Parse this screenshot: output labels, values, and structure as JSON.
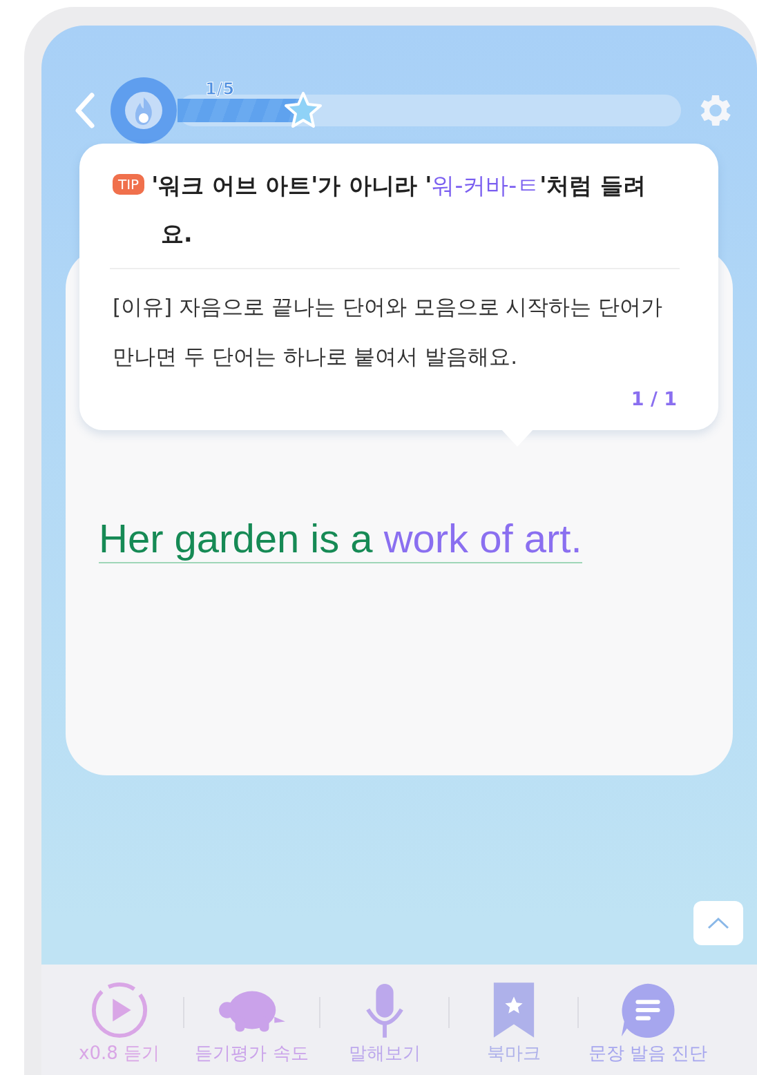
{
  "progress": {
    "label": "1/5",
    "level": 0.25
  },
  "tip": {
    "badge": "TIP",
    "headline": [
      {
        "text": "'워크 어브 아트'가 아니라 '",
        "highlight": false
      },
      {
        "text": "워-커바-ㅌ",
        "highlight": true
      },
      {
        "text": "'처럼 들려요.",
        "highlight": false
      }
    ],
    "body": "[이유] 자음으로 끝나는 단어와 모음으로 시작하는 단어가 만나면 두 단어는 하나로 붙여서 발음해요.",
    "page": "1 / 1"
  },
  "sentence": [
    {
      "text": "Her garden is a ",
      "highlight": false
    },
    {
      "text": "work of art.",
      "highlight": true
    }
  ],
  "toolbar": [
    {
      "kind": "play",
      "label": "x0.8 듣기"
    },
    {
      "kind": "turtle",
      "label": "듣기평가 속도"
    },
    {
      "kind": "mic",
      "label": "말해보기"
    },
    {
      "kind": "bookmark",
      "label": "북마크"
    },
    {
      "kind": "chat",
      "label": "문장 발음 진단"
    }
  ]
}
